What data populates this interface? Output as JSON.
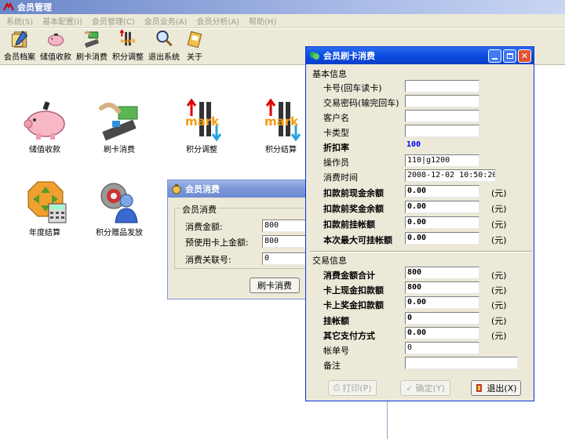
{
  "main": {
    "title": "会员管理",
    "menu": [
      "系统(S)",
      "基本配置(I)",
      "会员管理(C)",
      "会员业务(A)",
      "会员分析(A)",
      "帮助(H)"
    ],
    "toolbar": [
      {
        "label": "会员档案",
        "icon": "member-file-icon"
      },
      {
        "label": "储值收款",
        "icon": "piggy-bank-icon"
      },
      {
        "label": "刷卡消费",
        "icon": "card-swipe-icon"
      },
      {
        "label": "积分调整",
        "icon": "points-adjust-icon"
      },
      {
        "label": "退出系统",
        "icon": "magnifier-icon"
      },
      {
        "label": "关于",
        "icon": "about-icon"
      }
    ]
  },
  "desktop": [
    {
      "label": "储值收款",
      "icon": "piggy-bank-icon"
    },
    {
      "label": "刷卡消费",
      "icon": "card-swipe-icon"
    },
    {
      "label": "积分调整",
      "icon": "points-adjust-icon"
    },
    {
      "label": "积分结算",
      "icon": "points-settle-icon"
    },
    {
      "label": "年度结算",
      "icon": "annual-settle-icon"
    },
    {
      "label": "积分赠品发放",
      "icon": "gift-user-icon"
    }
  ],
  "consume_dialog": {
    "title": "会员消费",
    "group": "会员消费",
    "fields": [
      {
        "label": "消费金额:",
        "value": "800"
      },
      {
        "label": "预使用卡上金额:",
        "value": "800"
      },
      {
        "label": "消费关联号:",
        "value": "0"
      }
    ],
    "button": "刷卡消费"
  },
  "swipe_dialog": {
    "title": "会员刷卡消费",
    "basic_group": "基本信息",
    "basic": [
      {
        "label": "卡号(回车读卡)",
        "value": "",
        "bold": false
      },
      {
        "label": "交易密码(输完回车)",
        "value": "",
        "bold": false
      },
      {
        "label": "客户名",
        "value": "",
        "bold": false
      },
      {
        "label": "卡类型",
        "value": "",
        "bold": false
      },
      {
        "label": "折扣率",
        "value": "100",
        "bold": true
      },
      {
        "label": "操作员",
        "value": "110|g1200",
        "bold": false
      },
      {
        "label": "消费时间",
        "value": "2008-12-02 10:50:20",
        "bold": false
      },
      {
        "label": "扣款前现金余额",
        "value": "0.00",
        "bold": true,
        "unit": "(元)"
      },
      {
        "label": "扣款前奖金余额",
        "value": "0.00",
        "bold": true,
        "unit": "(元)"
      },
      {
        "label": "扣款前挂帐额",
        "value": "0.00",
        "bold": true,
        "unit": "(元)"
      },
      {
        "label": "本次最大可挂帐额",
        "value": "0.00",
        "bold": true,
        "unit": "(元)"
      }
    ],
    "trade_group": "交易信息",
    "trade": [
      {
        "label": "消费金额合计",
        "value": "800",
        "bold": true,
        "unit": "(元)"
      },
      {
        "label": "卡上现金扣款额",
        "value": "800",
        "bold": true,
        "unit": "(元)"
      },
      {
        "label": "卡上奖金扣款额",
        "value": "0.00",
        "bold": true,
        "unit": "(元)"
      },
      {
        "label": "挂帐额",
        "value": "0",
        "bold": true,
        "unit": "(元)"
      },
      {
        "label": "其它支付方式",
        "value": "0.00",
        "bold": true,
        "unit": "(元)"
      },
      {
        "label": "帐单号",
        "value": "0",
        "bold": false
      },
      {
        "label": "备注",
        "value": "",
        "bold": false
      }
    ],
    "buttons": {
      "print": "打印(P)",
      "ok": "确定(Y)",
      "exit": "退出(X)"
    }
  },
  "colors": {
    "title_active": "#0a4ce0",
    "discount_value": "#0000ff"
  }
}
